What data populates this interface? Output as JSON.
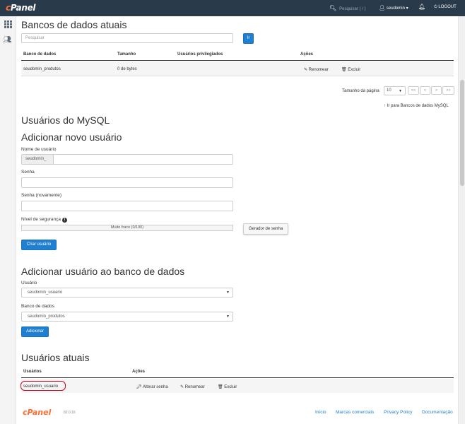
{
  "topbar": {
    "logo": "cPanel",
    "search_placeholder": "Pesquisar ( / )",
    "username": "seudomin",
    "logout_label": "LOGOUT"
  },
  "databases_section": {
    "title": "Bancos de dados atuais",
    "search_placeholder": "Pesquisar",
    "search_button": "Ir",
    "columns": [
      "Banco de dados",
      "Tamanho",
      "Usuários privilegiados",
      "Ações"
    ],
    "rows": [
      {
        "name": "seudomin_produtos",
        "size": "0 de bytes",
        "users": "",
        "rename": "Renomear",
        "delete": "Excluir"
      }
    ],
    "page_size_label": "Tamanho da página",
    "page_size_value": "10",
    "pager": [
      "<<",
      "<",
      ">",
      ">>"
    ],
    "go_to_link": "Ir para Bancos de dados MySQL"
  },
  "mysql_users": {
    "title": "Usuários do MySQL",
    "add_title": "Adicionar novo usuário",
    "username_label": "Nome de usuário",
    "username_prefix": "seudomin_",
    "password_label": "Senha",
    "password_again_label": "Senha (novamente)",
    "strength_label": "Nível de segurança",
    "strength_text": "Muito fraco (0/100)",
    "strength_value": 0,
    "generator_button": "Gerador de senha",
    "create_button": "Criar usuário"
  },
  "add_user_to_db": {
    "title": "Adicionar usuário ao banco de dados",
    "user_label": "Usuário",
    "user_value": "seudomin_usuario",
    "db_label": "Banco de dados",
    "db_value": "seudomin_produtos",
    "add_button": "Adicionar"
  },
  "current_users": {
    "title": "Usuários atuais",
    "columns": [
      "Usuários",
      "Ações"
    ],
    "rows": [
      {
        "name": "seudomin_usuario",
        "change_password": "Alterar senha",
        "rename": "Renomear",
        "delete": "Excluir"
      }
    ]
  },
  "footer": {
    "logo": "cPanel",
    "version": "82.0.16",
    "links": [
      "Início",
      "Marcas comerciais",
      "Privacy Policy",
      "Documentação"
    ]
  },
  "colors": {
    "topbar": "#293a4a",
    "accent": "#1f7fd0",
    "logo_orange": "#ff6c2c",
    "highlight_red": "#d0021b"
  }
}
